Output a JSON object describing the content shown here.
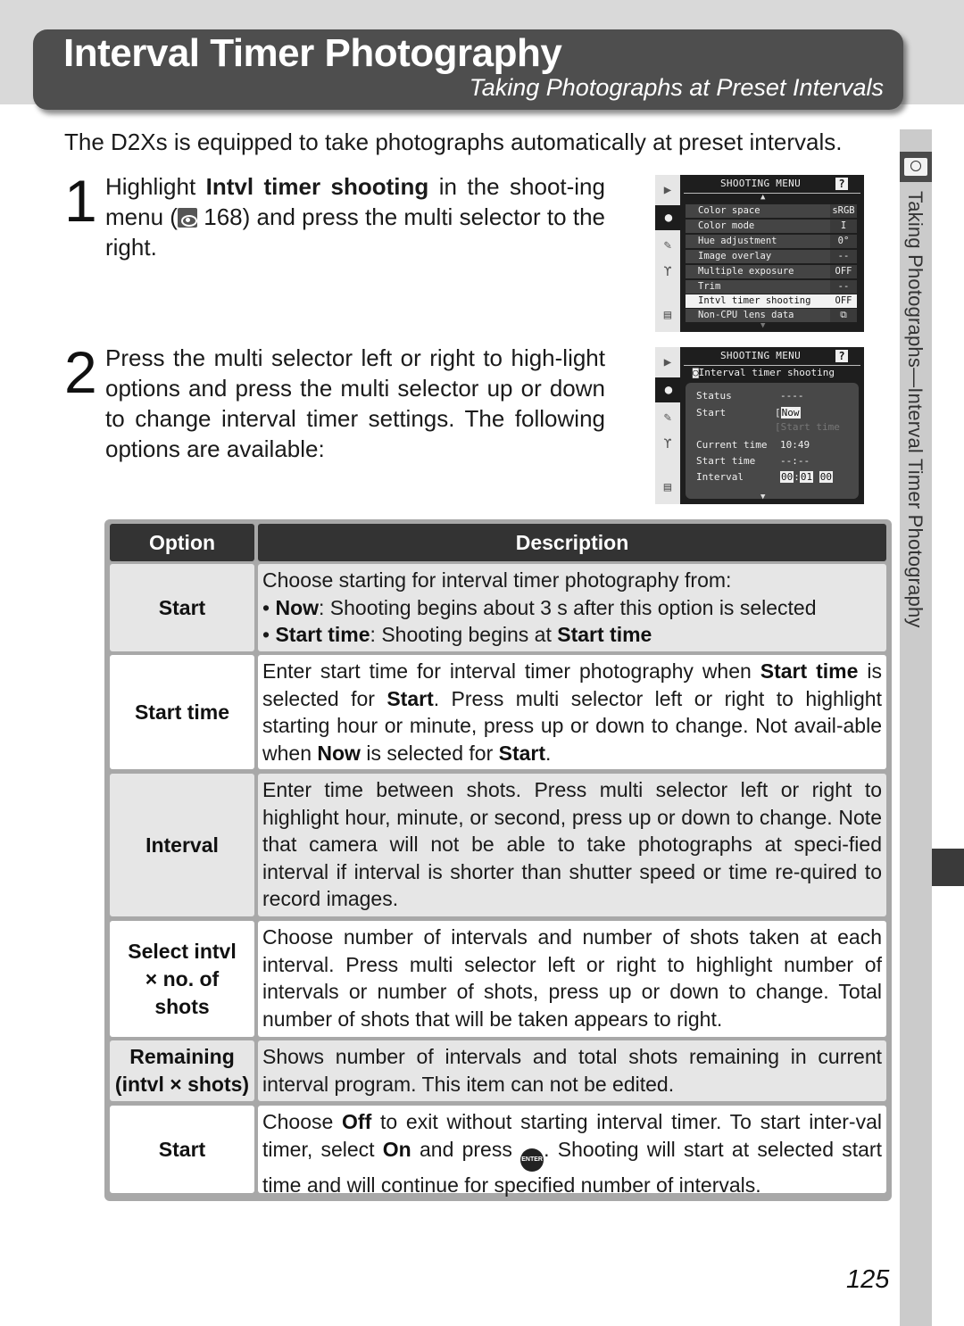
{
  "header": {
    "title": "Interval Timer Photography",
    "subtitle": "Taking Photographs at Preset Intervals"
  },
  "intro": "The D2Xs is equipped to take photographs automatically at preset intervals.",
  "steps": [
    {
      "number": "1",
      "text_before": "Highlight ",
      "bold": "Intvl timer shooting",
      "text_after": " in the shoot-ing menu (",
      "ref_icon": "menu-reference-icon",
      "ref_page": " 168) and press the multi selector to the right."
    },
    {
      "number": "2",
      "text": "Press the multi selector left or right to high-light options and press the multi selector up or down to change interval timer settings.  The following options are available:"
    }
  ],
  "screen1": {
    "title": "SHOOTING MENU",
    "help": "?",
    "side_icons": [
      "playback-icon",
      "camera-icon",
      "pencil-icon",
      "wrench-icon",
      "recent-icon"
    ],
    "rows": [
      {
        "label": "Color space",
        "value": "sRGB"
      },
      {
        "label": "Color mode",
        "value": "I"
      },
      {
        "label": "Hue adjustment",
        "value": "0°"
      },
      {
        "label": "Image overlay",
        "value": "--"
      },
      {
        "label": "Multiple exposure",
        "value": "OFF"
      },
      {
        "label": "Trim",
        "value": "--"
      },
      {
        "label": "Intvl timer shooting",
        "value": "OFF",
        "selected": true
      },
      {
        "label": "Non-CPU lens data",
        "value": "⧉"
      }
    ]
  },
  "screen2": {
    "title": "SHOOTING MENU",
    "help": "?",
    "subtitle": "Interval timer shooting",
    "status_label": "Status",
    "status_value": "----",
    "start_label": "Start",
    "start_options": [
      "Now",
      "Start time"
    ],
    "current_time_label": "Current time",
    "current_time_value": "10:49",
    "start_time_label": "Start time",
    "start_time_value": "--:--",
    "interval_label": "Interval",
    "interval_hours": "00",
    "interval_minutes": "01",
    "interval_seconds": "00"
  },
  "side_tab": {
    "label": "Taking Photographs—Interval Timer Photography",
    "icon": "camera-timer-icon"
  },
  "table": {
    "headers": {
      "option": "Option",
      "description": "Description"
    },
    "rows": [
      {
        "option": "Start",
        "desc_line1": "Choose starting for interval timer photography from:",
        "b1_bold": "Now",
        "b1_text": ": Shooting begins about 3 s after this option is selected",
        "b2_bold": "Start time",
        "b2_text": ": Shooting begins at ",
        "b2_bold2": "Start time"
      },
      {
        "option": "Start time",
        "t1": "Enter start time for interval timer photography when ",
        "b1": "Start time",
        "t2": " is selected for ",
        "b2": "Start",
        "t3": ".  Press multi selector left or right to highlight starting hour or minute, press up or down to change.  Not avail-able when ",
        "b3": "Now",
        "t4": " is selected for ",
        "b4": "Start",
        "t5": "."
      },
      {
        "option": "Interval",
        "text": "Enter time between shots.  Press multi selector left or right to highlight hour, minute, or second, press up or down to change.  Note that camera will not be able to take photographs at speci-fied interval if interval is shorter than shutter speed or time re-quired to record images."
      },
      {
        "option_line1": "Select intvl",
        "option_line2": "× no. of",
        "option_line3": "shots",
        "text": "Choose number of intervals and number of shots taken at each interval.  Press multi selector left or right to highlight number of intervals or number of shots, press up or down to change.  Total number of shots that will be taken appears to right."
      },
      {
        "option_line1": "Remaining",
        "option_line2": "(intvl × shots)",
        "text": "Shows number of intervals and total shots remaining in current interval program.  This item can not be edited."
      },
      {
        "option": "Start",
        "t1": "Choose ",
        "b1": "Off",
        "t2": " to exit without starting interval timer.  To start inter-val timer, select ",
        "b2": "On",
        "t3": " and press ",
        "enter_icon": "ENTER",
        "t4": ".  Shooting will start at selected start time and will continue for specified number of intervals."
      }
    ]
  },
  "page_number": "125"
}
